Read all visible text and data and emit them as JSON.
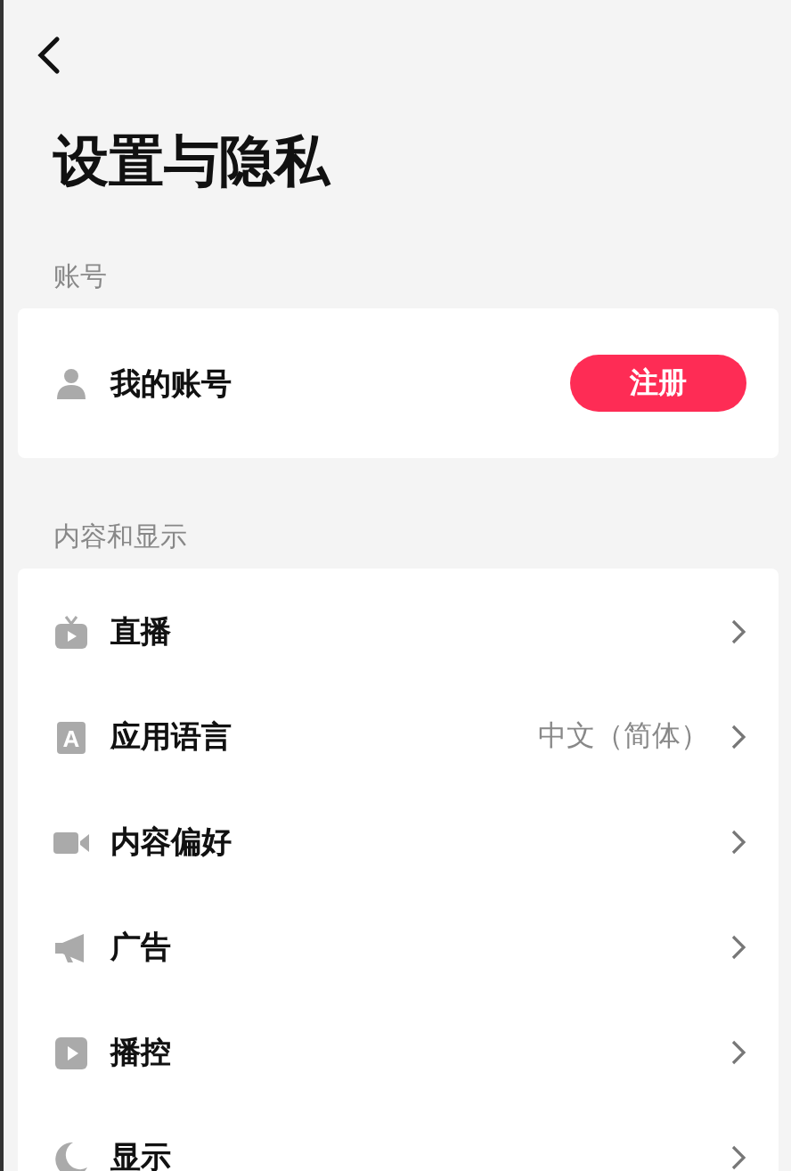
{
  "title": "设置与隐私",
  "sections": [
    {
      "heading": "账号",
      "items": [
        {
          "kind": "button",
          "label": "我的账号",
          "button": "注册"
        }
      ]
    },
    {
      "heading": "内容和显示",
      "items": [
        {
          "kind": "link",
          "label": "直播"
        },
        {
          "kind": "link",
          "icon_text": "A",
          "label": "应用语言",
          "value": "中文（简体）"
        },
        {
          "kind": "link",
          "label": "内容偏好"
        },
        {
          "kind": "link",
          "label": "广告"
        },
        {
          "kind": "link",
          "label": "播控"
        },
        {
          "kind": "link",
          "label": "显示"
        }
      ]
    }
  ]
}
